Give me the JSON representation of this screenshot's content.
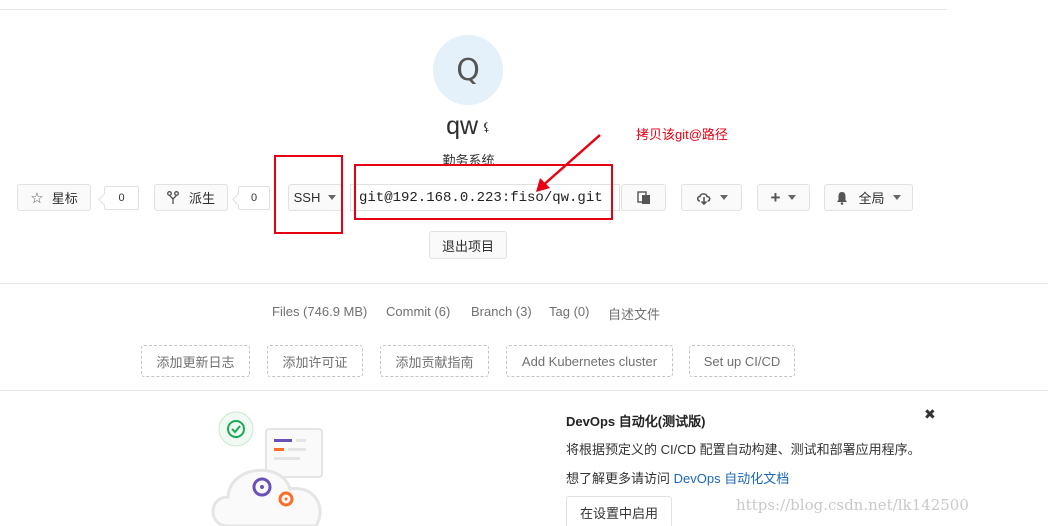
{
  "project": {
    "avatar_letter": "Q",
    "name": "qw",
    "visibility_icon": "lock-icon",
    "description": "勤务系统"
  },
  "actions": {
    "star_label": "星标",
    "star_count": "0",
    "fork_label": "派生",
    "fork_count": "0",
    "protocol": "SSH",
    "clone_url": "git@192.168.0.223:fiso/qw.git",
    "copy_icon": "clipboard-icon",
    "download_icon": "download-cloud-icon",
    "add_icon": "plus-icon",
    "notification_icon": "bell-icon",
    "notification_label": "全局",
    "leave_label": "退出项目"
  },
  "annotation": {
    "text": "拷贝该git@路径",
    "color": "#e60012"
  },
  "stats": {
    "files": "Files (746.9 MB)",
    "commits": "Commit (6)",
    "branches": "Branch (3)",
    "tags": "Tag (0)",
    "readme": "自述文件"
  },
  "quick_actions": [
    "添加更新日志",
    "添加许可证",
    "添加贡献指南",
    "Add Kubernetes cluster",
    "Set up CI/CD"
  ],
  "devops": {
    "title": "DevOps 自动化(测试版)",
    "close": "✖",
    "text": "将根据预定义的 CI/CD 配置自动构建、测试和部署应用程序。",
    "link_prefix": "想了解更多请访问 ",
    "link_text": "DevOps 自动化文档",
    "button_label": "在设置中启用"
  },
  "watermark": "https://blog.csdn.net/lk142500"
}
